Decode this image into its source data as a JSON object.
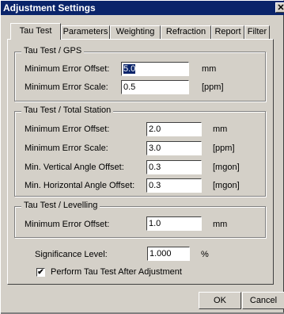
{
  "window": {
    "title": "Adjustment Settings",
    "close_glyph": "✕",
    "close_icon": "close-icon"
  },
  "tabs": [
    {
      "label": "Tau Test",
      "active": true
    },
    {
      "label": "Parameters",
      "active": false
    },
    {
      "label": "Weighting",
      "active": false
    },
    {
      "label": "Refraction",
      "active": false
    },
    {
      "label": "Report",
      "active": false
    },
    {
      "label": "Filter",
      "active": false
    }
  ],
  "groups": {
    "gps": {
      "title": "Tau Test / GPS",
      "fields": [
        {
          "label": "Minimum Error Offset:",
          "value": "5.0",
          "unit": "mm"
        },
        {
          "label": "Minimum Error Scale:",
          "value": "0.5",
          "unit": "[ppm]"
        }
      ]
    },
    "total_station": {
      "title": "Tau Test / Total Station",
      "fields": [
        {
          "label": "Minimum Error Offset:",
          "value": "2.0",
          "unit": "mm"
        },
        {
          "label": "Minimum Error Scale:",
          "value": "3.0",
          "unit": "[ppm]"
        },
        {
          "label": "Min. Vertical Angle Offset:",
          "value": "0.3",
          "unit": "[mgon]"
        },
        {
          "label": "Min. Horizontal Angle Offset:",
          "value": "0.3",
          "unit": "[mgon]"
        }
      ]
    },
    "levelling": {
      "title": "Tau Test / Levelling",
      "fields": [
        {
          "label": "Minimum Error Offset:",
          "value": "1.0",
          "unit": "mm"
        }
      ]
    }
  },
  "significance": {
    "label": "Significance Level:",
    "value": "1.000",
    "unit": "%"
  },
  "perform_checkbox": {
    "label": "Perform Tau Test After Adjustment",
    "checked": true,
    "mark": "✔"
  },
  "buttons": {
    "ok": "OK",
    "cancel": "Cancel"
  },
  "colors": {
    "face": "#d4d0c8",
    "titlebar": "#0a246a",
    "selection": "#0a246a"
  }
}
